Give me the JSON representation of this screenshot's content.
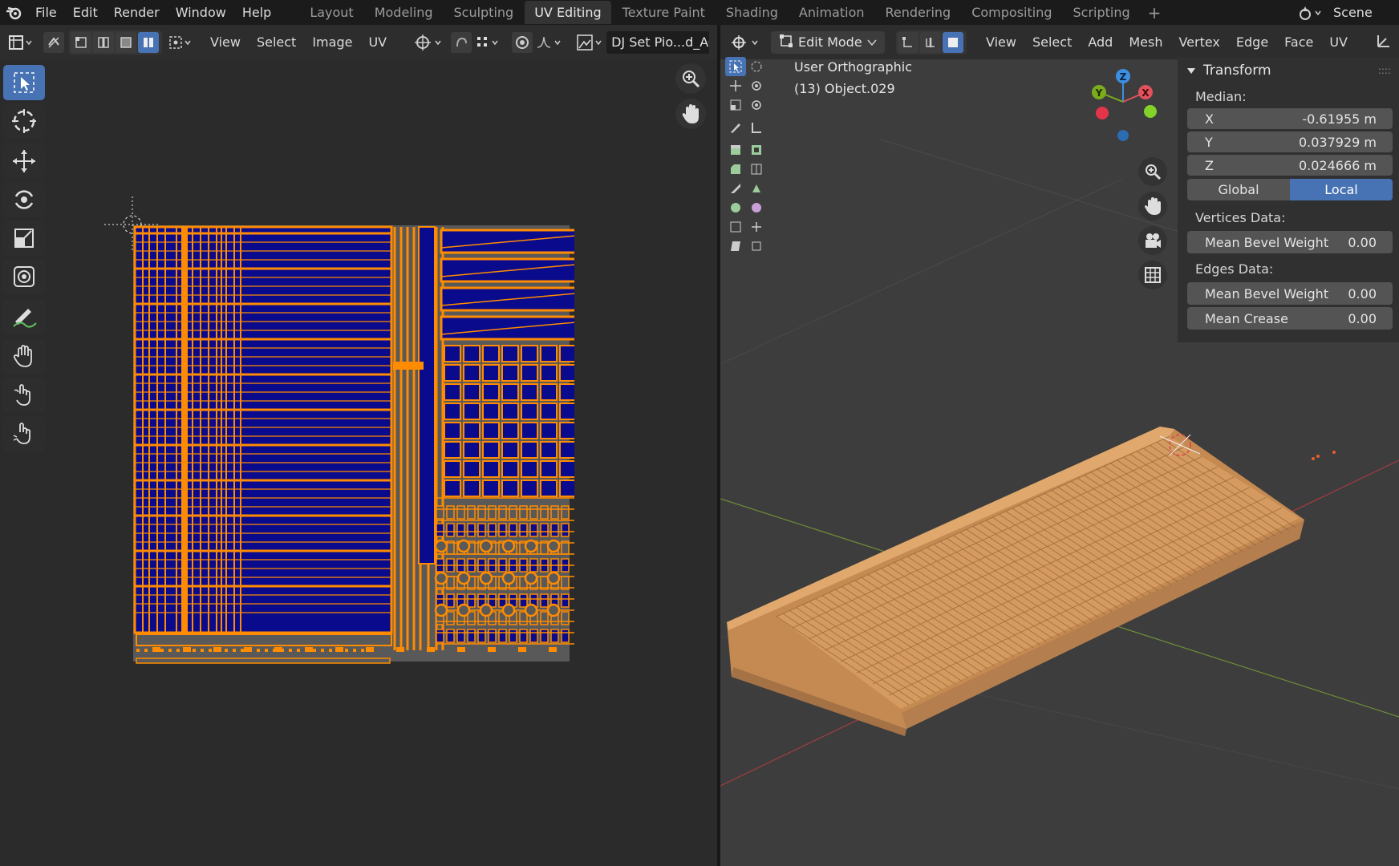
{
  "topbar": {
    "menus": [
      "File",
      "Edit",
      "Render",
      "Window",
      "Help"
    ],
    "workspaces": [
      "Layout",
      "Modeling",
      "Sculpting",
      "UV Editing",
      "Texture Paint",
      "Shading",
      "Animation",
      "Rendering",
      "Compositing",
      "Scripting"
    ],
    "active_workspace": "UV Editing",
    "scene": "Scene"
  },
  "uv_editor": {
    "menus": [
      "View",
      "Select",
      "Image",
      "UV"
    ],
    "image_name": "DJ Set Pio...d_AC"
  },
  "viewport": {
    "mode": "Edit Mode",
    "menus": [
      "View",
      "Select",
      "Add",
      "Mesh",
      "Vertex",
      "Edge",
      "Face",
      "UV"
    ],
    "view_name": "User Orthographic",
    "object_name": "(13) Object.029",
    "gizmo": {
      "z": "Z",
      "y": "Y",
      "x": "X"
    }
  },
  "transform_panel": {
    "title": "Transform",
    "median_label": "Median:",
    "x_label": "X",
    "x_value": "-0.61955 m",
    "y_label": "Y",
    "y_value": "0.037929 m",
    "z_label": "Z",
    "z_value": "0.024666 m",
    "global": "Global",
    "local": "Local",
    "vertices_label": "Vertices Data:",
    "v_bevel_label": "Mean Bevel Weight",
    "v_bevel_value": "0.00",
    "edges_label": "Edges Data:",
    "e_bevel_label": "Mean Bevel Weight",
    "e_bevel_value": "0.00",
    "crease_label": "Mean Crease",
    "crease_value": "0.00"
  },
  "colors": {
    "accent": "#4772b3",
    "uv_orange": "#ff8c00",
    "uv_fill": "#0a0a8c",
    "model": "#d4955a"
  }
}
